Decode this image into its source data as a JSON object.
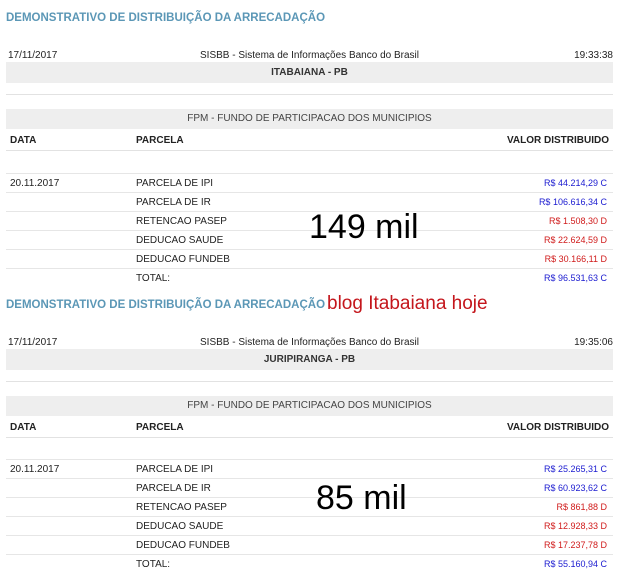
{
  "blocks": [
    {
      "title": "DEMONSTRATIVO DE DISTRIBUIÇÃO DA ARRECADAÇÃO",
      "date": "17/11/2017",
      "system": "SISBB - Sistema de Informações Banco do Brasil",
      "time": "19:33:38",
      "municipality": "ITABAIANA - PB",
      "fund": "FPM - FUNDO DE PARTICIPACAO DOS MUNICIPIOS",
      "col_data": "DATA",
      "col_parcela": "PARCELA",
      "col_valor": "VALOR DISTRIBUIDO",
      "rows": [
        {
          "date": "20.11.2017",
          "parcela": "PARCELA DE IPI",
          "valor": "R$ 44.214,29 C"
        },
        {
          "date": "",
          "parcela": "PARCELA DE IR",
          "valor": "R$ 106.616,34 C"
        },
        {
          "date": "",
          "parcela": "RETENCAO PASEP",
          "valor": "R$ 1.508,30 D"
        },
        {
          "date": "",
          "parcela": "DEDUCAO SAUDE",
          "valor": "R$ 22.624,59 D"
        },
        {
          "date": "",
          "parcela": "DEDUCAO FUNDEB",
          "valor": "R$ 30.166,11 D"
        },
        {
          "date": "",
          "parcela": "TOTAL:",
          "valor": "R$ 96.531,63 C"
        }
      ],
      "overlay": "149 mil"
    },
    {
      "title": "DEMONSTRATIVO DE DISTRIBUIÇÃO DA ARRECADAÇÃO",
      "date": "17/11/2017",
      "system": "SISBB - Sistema de Informações Banco do Brasil",
      "time": "19:35:06",
      "municipality": "JURIPIRANGA - PB",
      "fund": "FPM - FUNDO DE PARTICIPACAO DOS MUNICIPIOS",
      "col_data": "DATA",
      "col_parcela": "PARCELA",
      "col_valor": "VALOR DISTRIBUIDO",
      "rows": [
        {
          "date": "20.11.2017",
          "parcela": "PARCELA DE IPI",
          "valor": "R$ 25.265,31 C"
        },
        {
          "date": "",
          "parcela": "PARCELA DE IR",
          "valor": "R$ 60.923,62 C"
        },
        {
          "date": "",
          "parcela": "RETENCAO PASEP",
          "valor": "R$ 861,88 D"
        },
        {
          "date": "",
          "parcela": "DEDUCAO SAUDE",
          "valor": "R$ 12.928,33 D"
        },
        {
          "date": "",
          "parcela": "DEDUCAO FUNDEB",
          "valor": "R$ 17.237,78 D"
        },
        {
          "date": "",
          "parcela": "TOTAL:",
          "valor": "R$ 55.160,94 C"
        }
      ],
      "overlay": "85 mil"
    }
  ],
  "annotation": "blog Itabaiana hoje",
  "colors": {
    "header": "#5b97b6",
    "credit": "#1b1bd0",
    "debit": "#d01b1b",
    "annotation": "#c4161c"
  }
}
